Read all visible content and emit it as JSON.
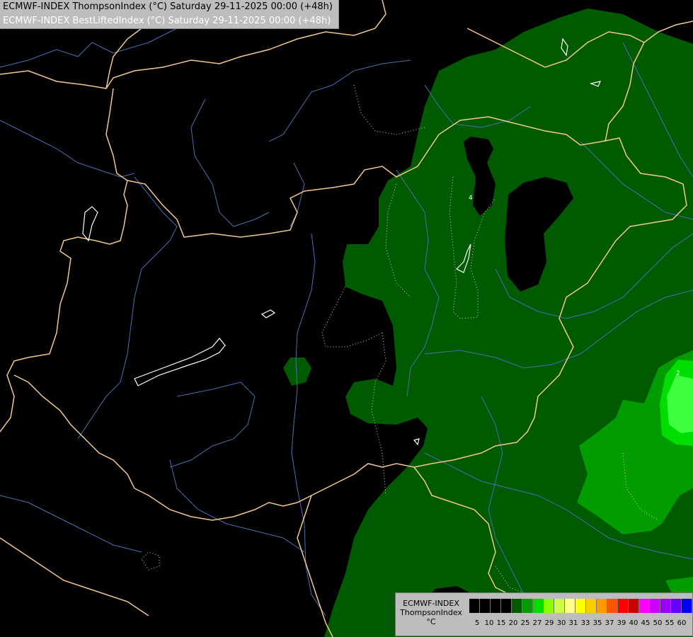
{
  "header": {
    "title_line1": "ECMWF-INDEX ThompsonIndex (°C) Saturday 29-11-2025 00:00 (+48h)",
    "title_line2": "ECMWF-INDEX BestLiftedIndex (°C) Saturday 29-11-2025 00:00 (+48h)"
  },
  "map": {
    "contour_labels": [
      "4",
      "2"
    ],
    "colors": {
      "background": "#000000",
      "borders": "#f0c890",
      "rivers": "#4a6fb0",
      "lakes": "#ffffff",
      "dark_green": "#005a00",
      "mid_green": "#009c00",
      "bright_green": "#00dd00",
      "light_green": "#40ff40"
    }
  },
  "legend": {
    "model": "ECMWF-INDEX",
    "parameter": "ThompsonIndex",
    "unit": "°C",
    "ticks": [
      "5",
      "10",
      "15",
      "20",
      "25",
      "27",
      "29",
      "30",
      "31",
      "33",
      "35",
      "37",
      "39",
      "40",
      "45",
      "50",
      "55",
      "60"
    ],
    "colors": [
      "#000000",
      "#000000",
      "#000000",
      "#000000",
      "#005a00",
      "#009c00",
      "#00dd00",
      "#88ff00",
      "#ccff44",
      "#ffff88",
      "#ffff00",
      "#ffcc00",
      "#ff9900",
      "#ff5500",
      "#ff0000",
      "#c80000",
      "#ff00ff",
      "#cc00ff",
      "#9900ff",
      "#6600ff",
      "#0000ff"
    ]
  }
}
